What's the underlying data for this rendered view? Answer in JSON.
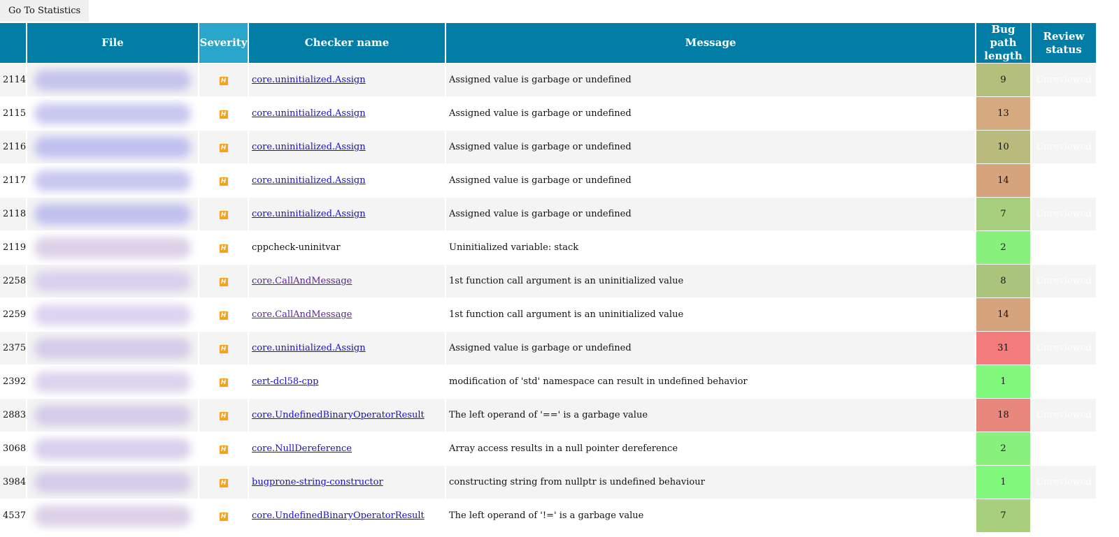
{
  "toolbar": {
    "go_to_statistics": "Go To Statistics"
  },
  "columns": [
    "",
    "File",
    "Severity",
    "Checker name",
    "Message",
    "Bug path length",
    "Review status"
  ],
  "columns_display": {
    "bpl1": "Bug path",
    "bpl2": "length",
    "rev1": "Review",
    "rev2": "status"
  },
  "severity_label": "H",
  "severity_color": "#f8a21c",
  "rows": [
    {
      "id": "2114",
      "checker": "core.uninitialized.Assign",
      "link": true,
      "visited": false,
      "message": "Assigned value is garbage or undefined",
      "bpl": "9",
      "color": "#b5bf7c",
      "review": "Unreviewed",
      "blur": "#c4c4ec"
    },
    {
      "id": "2115",
      "checker": "core.uninitialized.Assign",
      "link": true,
      "visited": false,
      "message": "Assigned value is garbage or undefined",
      "bpl": "13",
      "color": "#d4aa7e",
      "review": "Unreviewed",
      "blur": "#c8c8f0"
    },
    {
      "id": "2116",
      "checker": "core.uninitialized.Assign",
      "link": true,
      "visited": false,
      "message": "Assigned value is garbage or undefined",
      "bpl": "10",
      "color": "#b8bb7c",
      "review": "Unreviewed",
      "blur": "#c0c0f0"
    },
    {
      "id": "2117",
      "checker": "core.uninitialized.Assign",
      "link": true,
      "visited": false,
      "message": "Assigned value is garbage or undefined",
      "bpl": "14",
      "color": "#d6a47c",
      "review": "Unreviewed",
      "blur": "#c8c8f0"
    },
    {
      "id": "2118",
      "checker": "core.uninitialized.Assign",
      "link": true,
      "visited": false,
      "message": "Assigned value is garbage or undefined",
      "bpl": "7",
      "color": "#a8cf7c",
      "review": "Unreviewed",
      "blur": "#c0c0ee"
    },
    {
      "id": "2119",
      "checker": "cppcheck-uninitvar",
      "link": false,
      "visited": false,
      "message": "Uninitialized variable: stack",
      "bpl": "2",
      "color": "#88f07c",
      "review": "Unreviewed",
      "blur": "#dcd0e8"
    },
    {
      "id": "2258",
      "checker": "core.CallAndMessage",
      "link": true,
      "visited": true,
      "message": "1st function call argument is an uninitialized value",
      "bpl": "8",
      "color": "#abc47c",
      "review": "Unreviewed",
      "blur": "#d8d0ec"
    },
    {
      "id": "2259",
      "checker": "core.CallAndMessage",
      "link": true,
      "visited": true,
      "message": "1st function call argument is an uninitialized value",
      "bpl": "14",
      "color": "#d6a47c",
      "review": "Unreviewed",
      "blur": "#dcd4f0"
    },
    {
      "id": "2375",
      "checker": "core.uninitialized.Assign",
      "link": true,
      "visited": false,
      "message": "Assigned value is garbage or undefined",
      "bpl": "31",
      "color": "#f47c7c",
      "review": "Unreviewed",
      "blur": "#d4cce8"
    },
    {
      "id": "2392",
      "checker": "cert-dcl58-cpp",
      "link": true,
      "visited": false,
      "message": "modification of 'std' namespace can result in undefined behavior",
      "bpl": "1",
      "color": "#80f87c",
      "review": "Unreviewed",
      "blur": "#dcd4ec"
    },
    {
      "id": "2883",
      "checker": "core.UndefinedBinaryOperatorResult",
      "link": true,
      "visited": false,
      "message": "The left operand of '==' is a garbage value",
      "bpl": "18",
      "color": "#e8887c",
      "review": "Unreviewed",
      "blur": "#d4cce8"
    },
    {
      "id": "3068",
      "checker": "core.NullDereference",
      "link": true,
      "visited": false,
      "message": "Array access results in a null pointer dereference",
      "bpl": "2",
      "color": "#88f07c",
      "review": "Unreviewed",
      "blur": "#d8d0ec"
    },
    {
      "id": "3984",
      "checker": "bugprone-string-constructor",
      "link": true,
      "visited": false,
      "message": "constructing string from nullptr is undefined behaviour",
      "bpl": "1",
      "color": "#80f87c",
      "review": "Unreviewed",
      "blur": "#d4cce8"
    },
    {
      "id": "4537",
      "checker": "core.UndefinedBinaryOperatorResult",
      "link": true,
      "visited": false,
      "message": "The left operand of '!=' is a garbage value",
      "bpl": "7",
      "color": "#a8cf7c",
      "review": "Unreviewed",
      "blur": "#dcd0e8"
    }
  ]
}
